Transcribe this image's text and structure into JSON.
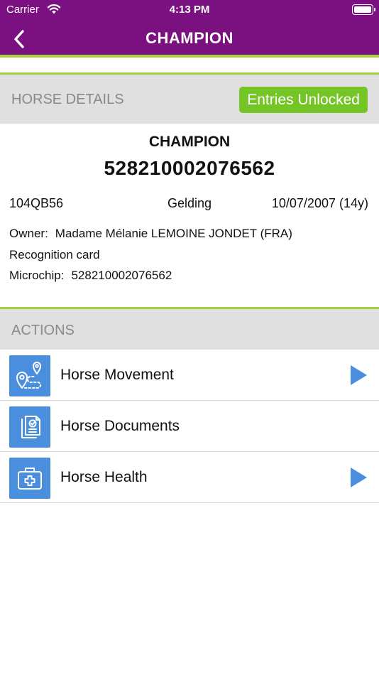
{
  "status_bar": {
    "carrier": "Carrier",
    "time": "4:13 PM"
  },
  "nav": {
    "title": "CHAMPION"
  },
  "horse_details": {
    "section_title": "HORSE DETAILS",
    "badge": "Entries Unlocked",
    "name": "CHAMPION",
    "id_number": "528210002076562",
    "code": "104QB56",
    "sex": "Gelding",
    "birth": "10/07/2007 (14y)",
    "owner_label": "Owner:",
    "owner_value": "Madame Mélanie LEMOINE JONDET (FRA)",
    "recognition": "Recognition card",
    "microchip_label": "Microchip:",
    "microchip_value": "528210002076562"
  },
  "actions": {
    "section_title": "ACTIONS",
    "items": [
      {
        "label": "Horse Movement",
        "icon": "map-route-icon",
        "has_arrow": true
      },
      {
        "label": "Horse Documents",
        "icon": "documents-icon",
        "has_arrow": false
      },
      {
        "label": "Horse Health",
        "icon": "first-aid-kit-icon",
        "has_arrow": true
      }
    ]
  },
  "colors": {
    "header": "#7b1180",
    "accent_green": "#a7cf3c",
    "badge_green": "#76c527",
    "icon_blue": "#4a8fdd"
  }
}
